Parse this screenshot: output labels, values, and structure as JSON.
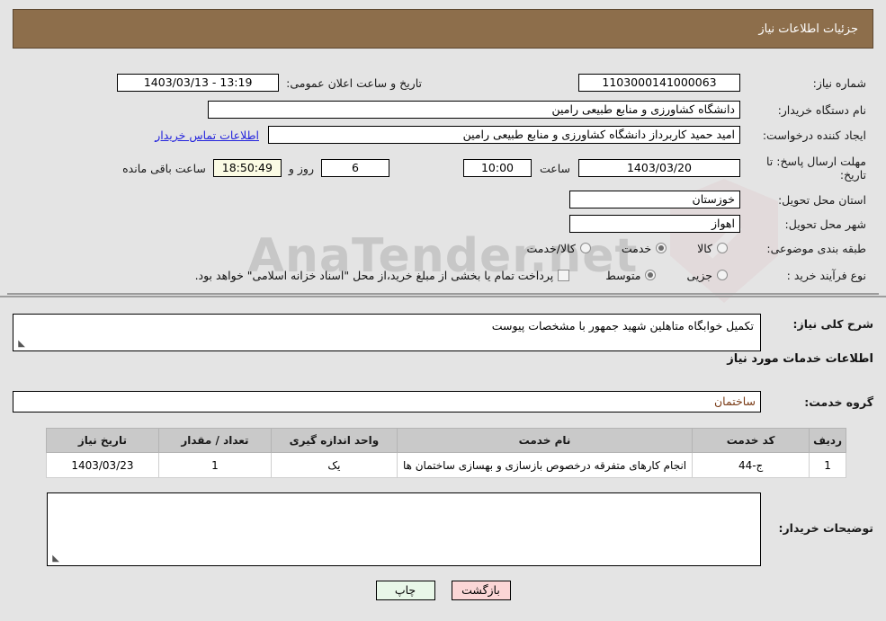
{
  "header": {
    "title": "جزئیات اطلاعات نیاز",
    "bg_color": "#8d6e4b"
  },
  "watermark": {
    "text": "AnaTender.net"
  },
  "top_form": {
    "need_number_label": "شماره نیاز:",
    "need_number_value": "1103000141000063",
    "public_announce_label": "تاریخ و ساعت اعلان عمومی:",
    "public_announce_value": "13:19 - 1403/03/13",
    "buyer_org_label": "نام دستگاه خریدار:",
    "buyer_org_value": "دانشگاه کشاورزی و منابع طبیعی رامین",
    "requester_label": "ایجاد کننده درخواست:",
    "requester_value": "امید حمید کاربرداز دانشگاه کشاورزی و منابع طبیعی رامین",
    "buyer_contact_link": "اطلاعات تماس خریدار",
    "deadline_label": "مهلت ارسال پاسخ: تا تاریخ:",
    "deadline_date": "1403/03/20",
    "deadline_hour_label": "ساعت",
    "deadline_hour_value": "10:00",
    "remaining_days_value": "6",
    "remaining_days_label": "روز و",
    "remaining_time_value": "18:50:49",
    "remaining_time_label": "ساعت باقی مانده",
    "province_label": "استان محل تحویل:",
    "province_value": "خوزستان",
    "city_label": "شهر محل تحویل:",
    "city_value": "اهواز",
    "category_label": "طبقه بندی موضوعی:",
    "category_options": [
      {
        "label": "کالا",
        "selected": false
      },
      {
        "label": "خدمت",
        "selected": true
      },
      {
        "label": "کالا/خدمت",
        "selected": false
      }
    ],
    "process_label": "نوع فرآیند خرید :",
    "process_options": [
      {
        "label": "جزیی",
        "selected": false
      },
      {
        "label": "متوسط",
        "selected": true
      }
    ],
    "treasury_checkbox_label": "پرداخت تمام یا بخشی از مبلغ خرید،از محل \"اسناد خزانه اسلامی\" خواهد بود.",
    "treasury_checked": false
  },
  "description": {
    "label": "شرح کلی نیاز:",
    "value": "تکمیل خوابگاه متاهلین شهید جمهور با مشخصات پیوست"
  },
  "services_section": {
    "heading": "اطلاعات خدمات مورد نیاز",
    "group_label": "گروه خدمت:",
    "group_value": "ساختمان"
  },
  "table": {
    "columns": [
      "ردیف",
      "کد خدمت",
      "نام خدمت",
      "واحد اندازه گیری",
      "تعداد / مقدار",
      "تاریخ نیاز"
    ],
    "rows": [
      {
        "row_no": "1",
        "service_code": "ج-44",
        "service_name": "انجام کارهای متفرقه درخصوص بازسازی و بهسازی ساختمان ها",
        "unit": "یک",
        "quantity": "1",
        "need_date": "1403/03/23"
      }
    ]
  },
  "buyer_notes": {
    "label": "توضیحات خریدار:",
    "value": ""
  },
  "footer": {
    "print_label": "چاپ",
    "back_label": "بازگشت"
  }
}
